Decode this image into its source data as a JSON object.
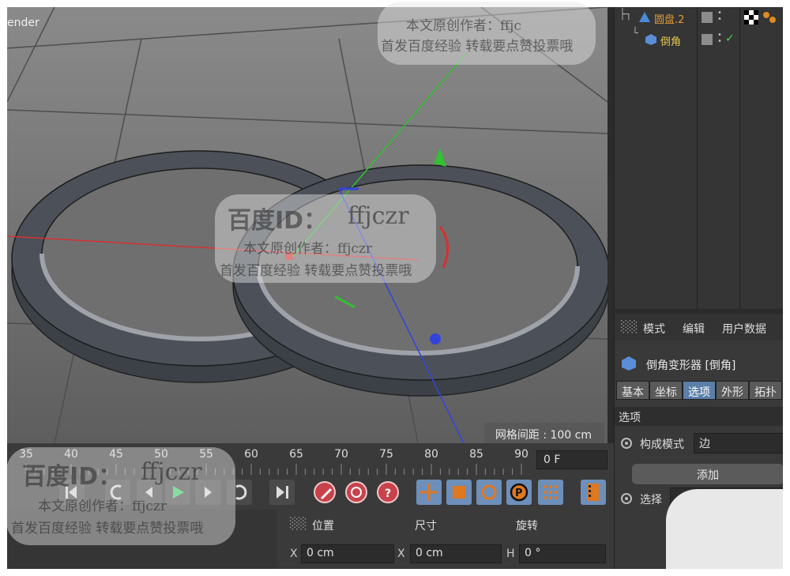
{
  "viewport": {
    "title": "ender",
    "grid_spacing_label": "网格间距 : 100 cm"
  },
  "objects": {
    "items": [
      {
        "name": "圆盘.2",
        "color": "#e09a3a",
        "icon": "polygon-disc-icon"
      },
      {
        "name": "倒角",
        "color": "#e8c84a",
        "icon": "bevel-deformer-icon"
      }
    ]
  },
  "attributes": {
    "menu": [
      "模式",
      "编辑",
      "用户数据"
    ],
    "object_title": "倒角变形器 [倒角]",
    "tabs": [
      "基本",
      "坐标",
      "选项",
      "外形",
      "拓扑"
    ],
    "active_tab": "选项",
    "section": "选项",
    "build_mode_label": "构成模式",
    "build_mode_value": "边",
    "add_button": "添加",
    "select_label": "选择"
  },
  "timeline": {
    "ticks": [
      "35",
      "40",
      "45",
      "50",
      "55",
      "60",
      "65",
      "70",
      "75",
      "80",
      "85",
      "90"
    ],
    "current_frame": "0 F"
  },
  "coords": {
    "headers": [
      "位置",
      "尺寸",
      "旋转"
    ],
    "x_label": "X",
    "x_pos": "0 cm",
    "x_size_label": "X",
    "x_size": "0 cm",
    "h_label": "H",
    "h_rot": "0 °"
  },
  "watermark": {
    "id_text": "百度ID：",
    "id_value": "ffjczr",
    "author": "本文原创作者：ffjczr",
    "author_top": "本文原创作者：ffjc",
    "notice": "首发百度经验 转载要点赞投票哦"
  },
  "colors": {
    "accent_blue": "#6d8fb9",
    "axis_x": "#d83030",
    "axis_y": "#33c033",
    "axis_z": "#3344dd"
  }
}
